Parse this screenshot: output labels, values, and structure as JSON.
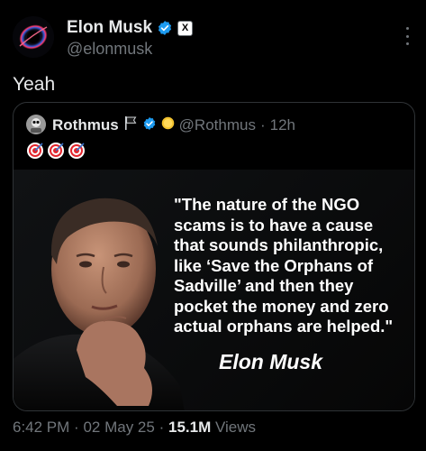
{
  "author": {
    "name": "Elon Musk",
    "handle": "@elonmusk",
    "affiliation_badge": "X"
  },
  "tweet": {
    "text": "Yeah"
  },
  "quoted": {
    "name": "Rothmus",
    "handle": "@Rothmus",
    "separator": "·",
    "time": "12h",
    "emoji": [
      "target-icon",
      "target-icon",
      "target-icon"
    ],
    "image": {
      "quote": "\"The nature of the NGO\nscams is to have a cause\nthat sounds philanthropic,\nlike ‘Save the Orphans of\nSadville’ and then they\npocket the money and zero\nactual orphans are helped.\"",
      "attribution": "Elon Musk"
    }
  },
  "meta": {
    "time": "6:42 PM",
    "sep1": "·",
    "date": "02 May 25",
    "sep2": "·",
    "views_count": "15.1M",
    "views_label": "Views"
  },
  "colors": {
    "background": "#000000",
    "text": "#e7e9ea",
    "secondary": "#71767b",
    "verified": "#1d9bf0",
    "border": "#2f3336"
  }
}
